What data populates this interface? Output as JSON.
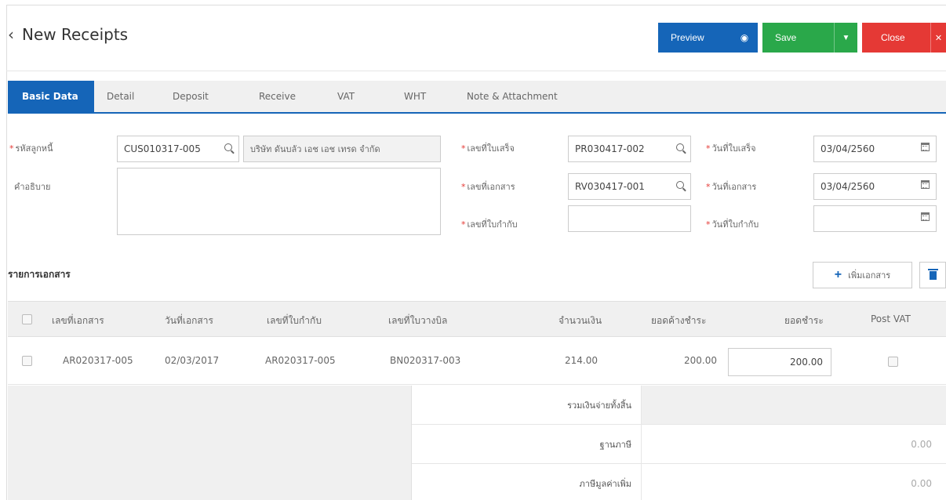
{
  "header": {
    "back_icon": "chevron-left-icon",
    "title": "New Receipts"
  },
  "actions": {
    "preview": "Preview",
    "save": "Save",
    "close": "Close"
  },
  "tabs": [
    "Basic Data",
    "Detail",
    "Deposit",
    "Receive",
    "VAT",
    "WHT",
    "Note & Attachment"
  ],
  "form": {
    "customer_code_label": "รหัสลูกหนี้",
    "customer_code": "CUS010317-005",
    "customer_name": "บริษัท ดันบลัว เอช เอช เทรด จำกัด",
    "description_label": "คำอธิบาย",
    "receipt_no_label": "เลขที่ใบเสร็จ",
    "receipt_no": "PR030417-002",
    "doc_no_label": "เลขที่เอกสาร",
    "doc_no": "RV030417-001",
    "tax_inv_no_label": "เลขที่ใบกำกับ",
    "tax_inv_no": "",
    "receipt_date_label": "วันที่ใบเสร็จ",
    "receipt_date": "03/04/2560",
    "doc_date_label": "วันที่เอกสาร",
    "doc_date": "03/04/2560",
    "tax_inv_date_label": "วันที่ใบกำกับ",
    "tax_inv_date": ""
  },
  "documents": {
    "title": "รายการเอกสาร",
    "add_label": "เพิ่มเอกสาร",
    "columns": [
      "เลขที่เอกสาร",
      "วันที่เอกสาร",
      "เลขที่ใบกำกับ",
      "เลขที่ใบวางบิล",
      "จำนวนเงิน",
      "ยอดค้างชำระ",
      "ยอดชำระ",
      "Post VAT"
    ],
    "rows": [
      {
        "doc_no": "AR020317-005",
        "doc_date": "02/03/2017",
        "tax_inv_no": "AR020317-005",
        "bill_no": "BN020317-003",
        "amount": "214.00",
        "outstanding": "200.00",
        "payment": "200.00"
      }
    ]
  },
  "summary": {
    "total_label": "รวมเงินจ่ายทั้งสิ้น",
    "total_value": "",
    "tax_base_label": "ฐานภาษี",
    "tax_base_value": "0.00",
    "vat_label": "ภาษีมูลค่าเพิ่ม",
    "vat_value": "0.00"
  },
  "colors": {
    "primary": "#1565b8",
    "save": "#2aa84a",
    "close": "#e53935",
    "required": "#e53935"
  }
}
